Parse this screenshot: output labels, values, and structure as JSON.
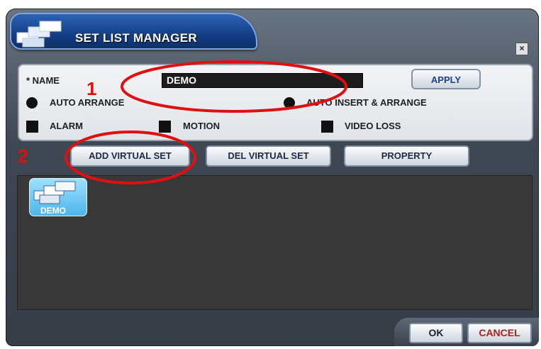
{
  "window": {
    "title": "SET LIST MANAGER",
    "close_glyph": "×"
  },
  "settings": {
    "name_label": "* NAME",
    "name_value": "DEMO",
    "apply_label": "APPLY",
    "auto_arrange_label": "AUTO ARRANGE",
    "auto_insert_label": "AUTO INSERT & ARRANGE",
    "alarm_label": "ALARM",
    "motion_label": "MOTION",
    "video_loss_label": "VIDEO LOSS"
  },
  "toolbar": {
    "add_virtual_set": "ADD VIRTUAL SET",
    "del_virtual_set": "DEL VIRTUAL SET",
    "property": "PROPERTY"
  },
  "set_list": [
    {
      "name": "DEMO",
      "icon": "monitor-stack-icon"
    }
  ],
  "footer": {
    "ok": "OK",
    "cancel": "CANCEL"
  },
  "annotations": {
    "step1": "1",
    "step2": "2"
  },
  "colors": {
    "highlight": "#e01010",
    "name_field_bg": "#1d1d1d",
    "list_bg": "#383838"
  }
}
